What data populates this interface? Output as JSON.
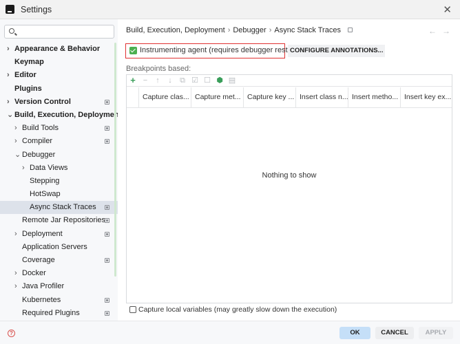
{
  "window": {
    "title": "Settings",
    "close_label": "✕"
  },
  "sidebar": {
    "search": {
      "value": "",
      "placeholder": ""
    },
    "items": [
      {
        "label": "Appearance & Behavior",
        "expand": "›",
        "bold": true,
        "badge": false
      },
      {
        "label": "Keymap",
        "expand": "",
        "bold": true,
        "badge": false
      },
      {
        "label": "Editor",
        "expand": "›",
        "bold": true,
        "badge": false
      },
      {
        "label": "Plugins",
        "expand": "",
        "bold": true,
        "badge": false
      },
      {
        "label": "Version Control",
        "expand": "›",
        "bold": true,
        "badge": true
      },
      {
        "label": "Build, Execution, Deployment",
        "expand": "⌄",
        "bold": true,
        "badge": false
      },
      {
        "label": "Build Tools",
        "expand": "›",
        "bold": false,
        "badge": true
      },
      {
        "label": "Compiler",
        "expand": "›",
        "bold": false,
        "badge": true
      },
      {
        "label": "Debugger",
        "expand": "⌄",
        "bold": false,
        "badge": false
      },
      {
        "label": "Data Views",
        "expand": "›",
        "bold": false,
        "badge": false
      },
      {
        "label": "Stepping",
        "expand": "",
        "bold": false,
        "badge": false
      },
      {
        "label": "HotSwap",
        "expand": "",
        "bold": false,
        "badge": false
      },
      {
        "label": "Async Stack Traces",
        "expand": "",
        "bold": false,
        "badge": true,
        "selected": true
      },
      {
        "label": "Remote Jar Repositories",
        "expand": "",
        "bold": false,
        "badge": true
      },
      {
        "label": "Deployment",
        "expand": "›",
        "bold": false,
        "badge": true
      },
      {
        "label": "Application Servers",
        "expand": "",
        "bold": false,
        "badge": false
      },
      {
        "label": "Coverage",
        "expand": "",
        "bold": false,
        "badge": true
      },
      {
        "label": "Docker",
        "expand": "›",
        "bold": false,
        "badge": false
      },
      {
        "label": "Java Profiler",
        "expand": "›",
        "bold": false,
        "badge": false
      },
      {
        "label": "Kubernetes",
        "expand": "",
        "bold": false,
        "badge": true
      },
      {
        "label": "Required Plugins",
        "expand": "",
        "bold": false,
        "badge": true
      }
    ]
  },
  "breadcrumb": {
    "parts": [
      "Build, Execution, Deployment",
      "Debugger",
      "Async Stack Traces"
    ],
    "separator": "›",
    "back": "←",
    "forward": "→"
  },
  "agent": {
    "checked": true,
    "label": "Instrumenting agent (requires debugger restart)"
  },
  "configure_button": "CONFIGURE ANNOTATIONS...",
  "breakpoints_label": "Breakpoints based:",
  "toolbar": {
    "add": "+",
    "remove": "−",
    "up": "↑",
    "down": "↓",
    "copy": "⧉",
    "check": "☑",
    "uncheck": "☐",
    "plugin": "⬢",
    "file": "▤"
  },
  "table": {
    "columns": [
      "Capture clas...",
      "Capture met...",
      "Capture key ...",
      "Insert class n...",
      "Insert metho...",
      "Insert key ex..."
    ],
    "empty_text": "Nothing to show"
  },
  "capture_locals": {
    "checked": false,
    "label": "Capture local variables (may greatly slow down the execution)"
  },
  "footer": {
    "help": "?",
    "ok": "OK",
    "cancel": "CANCEL",
    "apply": "APPLY"
  },
  "colors": {
    "accent_red": "#e03030",
    "check_green": "#4caf50",
    "ok_button": "#c5dff8",
    "selection": "#dde2ea"
  }
}
